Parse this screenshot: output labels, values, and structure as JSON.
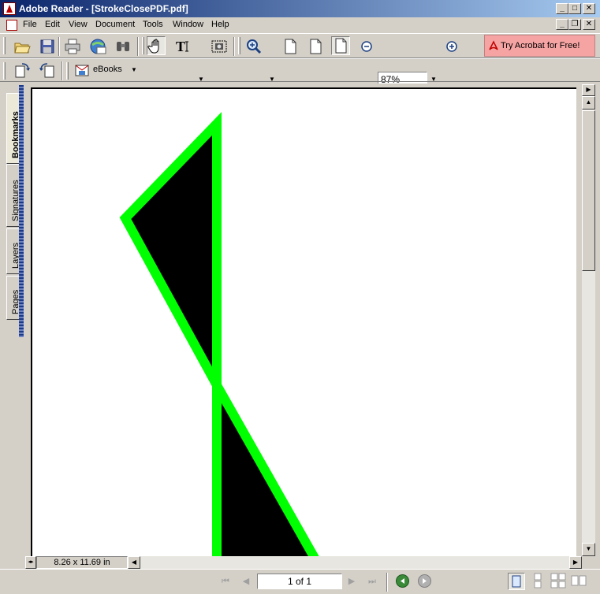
{
  "window": {
    "title": "Adobe Reader - [StrokeClosePDF.pdf]",
    "controls": {
      "minimize": "_",
      "maximize": "□",
      "close": "✕"
    }
  },
  "menu": {
    "items": [
      "File",
      "Edit",
      "View",
      "Document",
      "Tools",
      "Window",
      "Help"
    ],
    "doc_controls": {
      "minimize": "_",
      "restore": "❐",
      "close": "✕"
    }
  },
  "toolbar": {
    "zoom_value": "87%",
    "try_acrobat_label": "Try Acrobat for Free!",
    "ebooks_label": "eBooks",
    "icons": [
      "open-icon",
      "save-icon",
      "print-icon",
      "email-icon",
      "search-icon",
      "hand-tool-icon",
      "select-text-icon",
      "snapshot-icon",
      "zoom-in-tool-icon",
      "actual-size-icon",
      "fit-page-icon",
      "fit-width-icon",
      "zoom-out-icon",
      "zoom-in-icon"
    ]
  },
  "navpane": {
    "tabs": [
      "Bookmarks",
      "Signatures",
      "Layers",
      "Pages"
    ],
    "active_tab": "Bookmarks"
  },
  "document": {
    "page_size": "8.26 x 11.69 in",
    "stroke_color": "#00ff00",
    "fill_color": "#000000"
  },
  "statusbar": {
    "page_indicator": "1 of 1"
  }
}
